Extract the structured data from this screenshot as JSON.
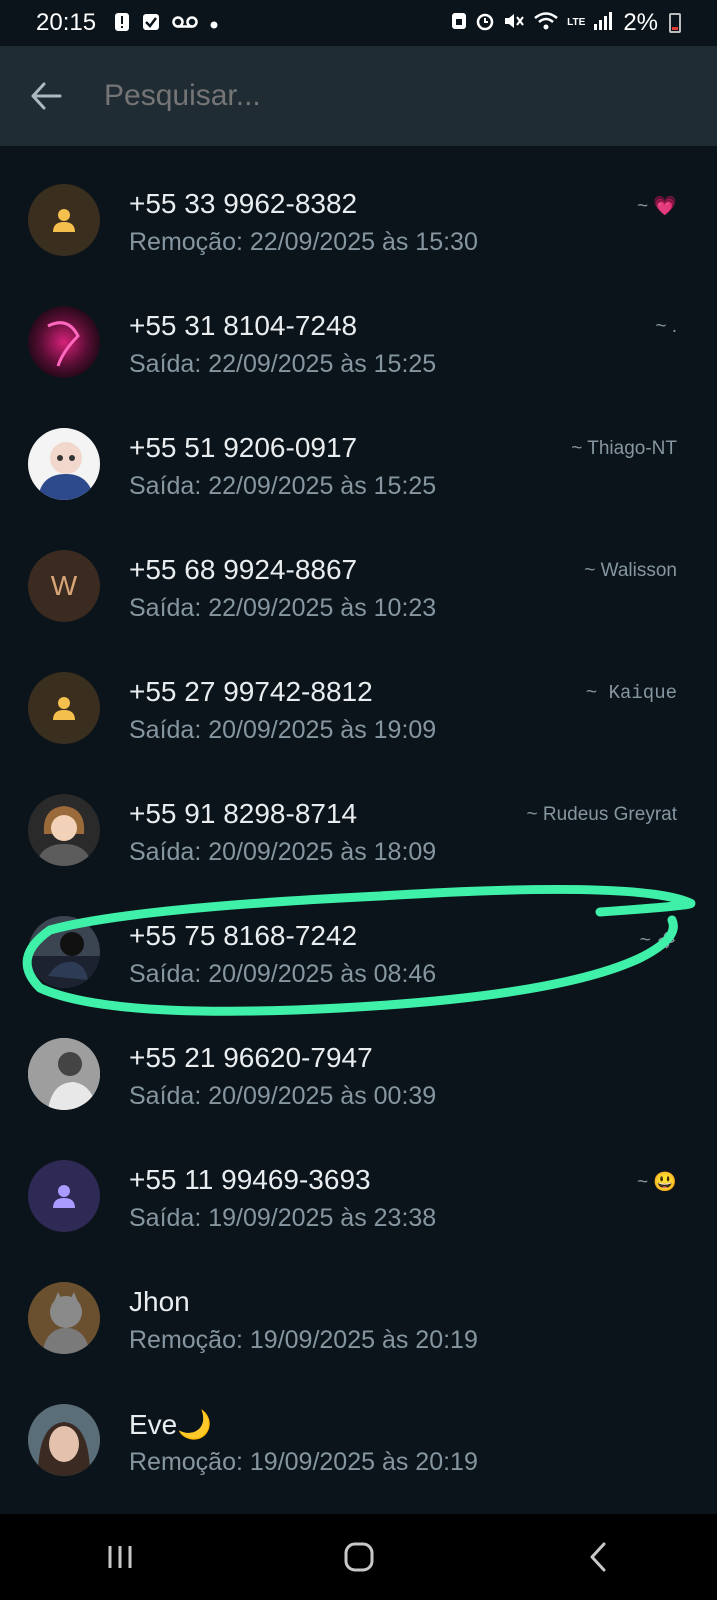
{
  "status_bar": {
    "time": "20:15",
    "battery": "2%",
    "network": "LTE"
  },
  "search": {
    "placeholder": "Pesquisar..."
  },
  "items": [
    {
      "number": "+55 33 9962-8382",
      "detail": "Remoção: 22/09/2025 às 15:30",
      "tag": "~ 💗",
      "avatar": "default-person-icon"
    },
    {
      "number": "+55 31 8104-7248",
      "detail": "Saída: 22/09/2025 às 15:25",
      "tag": "~ .",
      "avatar": "photo"
    },
    {
      "number": "+55 51 9206-0917",
      "detail": "Saída: 22/09/2025 às 15:25",
      "tag": "~ Thiago-NT",
      "avatar": "photo"
    },
    {
      "number": "+55 68 9924-8867",
      "detail": "Saída: 22/09/2025 às 10:23",
      "tag": "~ Walisson",
      "avatar_letter": "W"
    },
    {
      "number": "+55 27 99742-8812",
      "detail": "Saída: 20/09/2025 às 19:09",
      "tag": "~ Kaique",
      "avatar": "default-person-icon"
    },
    {
      "number": "+55 91 8298-8714",
      "detail": "Saída: 20/09/2025 às 18:09",
      "tag": "~ Rudeus Greyrat",
      "avatar": "photo"
    },
    {
      "number": "+55 75 8168-7242",
      "detail": "Saída: 20/09/2025 às 08:46",
      "tag": "~ ᯽",
      "avatar": "photo",
      "highlighted": true
    },
    {
      "number": "+55 21 96620-7947",
      "detail": "Saída: 20/09/2025 às 00:39",
      "tag": "",
      "avatar": "photo"
    },
    {
      "number": "+55 11 99469-3693",
      "detail": "Saída: 19/09/2025 às 23:38",
      "tag": "~ 😃",
      "avatar": "default-person-icon"
    },
    {
      "number": "Jhon",
      "detail": "Remoção: 19/09/2025 às 20:19",
      "tag": "",
      "avatar": "photo"
    },
    {
      "number": "Eve🌙",
      "detail": "Remoção: 19/09/2025 às 20:19",
      "tag": "",
      "avatar": "photo"
    }
  ],
  "colors": {
    "background": "#0b141a",
    "header": "#1f2c34",
    "highlight": "#3ef0a8"
  }
}
